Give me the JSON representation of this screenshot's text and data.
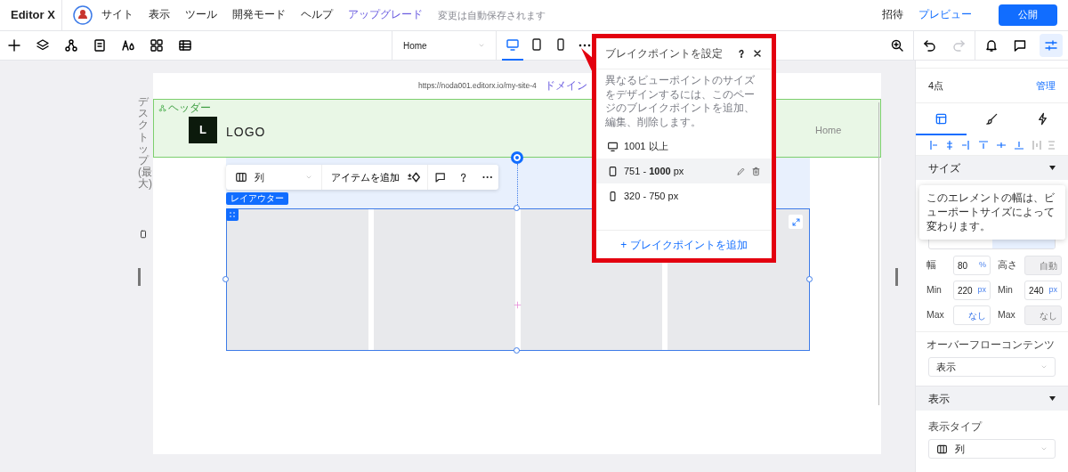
{
  "app": {
    "logo": "Editor X"
  },
  "menu": [
    {
      "label": "サイト",
      "kind": "item"
    },
    {
      "label": "表示",
      "kind": "item"
    },
    {
      "label": "ツール",
      "kind": "item"
    },
    {
      "label": "開発モード",
      "kind": "item"
    },
    {
      "label": "ヘルプ",
      "kind": "item"
    },
    {
      "label": "アップグレード",
      "kind": "upgrade"
    }
  ],
  "autosave_note": "変更は自動保存されます",
  "top_actions": {
    "invite": "招待",
    "preview": "プレビュー",
    "publish": "公開"
  },
  "toolbar": {
    "page_select": "Home",
    "devices": [
      {
        "kind": "desktop",
        "selected": true
      },
      {
        "kind": "tablet",
        "selected": false
      },
      {
        "kind": "mobile",
        "selected": false
      }
    ],
    "redo_disabled": true,
    "inspector_toggle_selected": true
  },
  "canvas": {
    "side_label": "デスクトップ (最大)",
    "url": "https://noda001.editorx.io/my-site-4",
    "domain_link": "ドメイン",
    "header": {
      "tag": "ヘッダー",
      "logo_letter": "L",
      "logo_text": "LOGO",
      "nav_item": "Home"
    },
    "section_toolbar": {
      "layout_select": "列",
      "add_item": "アイテムを追加"
    },
    "layouter_tag": "レイアウター",
    "columns": [
      {
        "kind": "cell"
      },
      {
        "kind": "cell"
      },
      {
        "kind": "cell"
      },
      {
        "kind": "cell"
      }
    ]
  },
  "breakpoints_popover": {
    "title": "ブレイクポイントを設定",
    "description": "異なるビューポイントのサイズをデザインするには、このページのブレイクポイントを追加、編集、削除します。",
    "items": [
      {
        "kind": "desktop",
        "label": "1001 以上",
        "selected": false
      },
      {
        "kind": "tablet",
        "label": "751 - **1000** px",
        "selected": true
      },
      {
        "kind": "mobile",
        "label": "320 - 750 px",
        "selected": false
      }
    ],
    "add_button": "+ ブレイクポイントを追加"
  },
  "inspector": {
    "count": "4点",
    "manage": "管理",
    "tabs": [
      {
        "kind": "layout",
        "selected": true
      },
      {
        "kind": "design",
        "selected": false
      },
      {
        "kind": "interactions",
        "selected": false
      }
    ],
    "size_section": {
      "title": "サイズ",
      "tooltip": "このエレメントの幅は、ビューポートサイズによって変わります。"
    },
    "fields": [
      {
        "label": "幅",
        "value": "80",
        "unit": "%",
        "disabled": false
      },
      {
        "label": "高さ",
        "value": "自動",
        "disabled": true
      },
      {
        "label": "Min",
        "value": "220",
        "unit": "px",
        "disabled": false
      },
      {
        "label": "Min",
        "value": "240",
        "unit": "px",
        "disabled": false
      },
      {
        "label": "Max",
        "value": "なし",
        "disabled": false
      },
      {
        "label": "Max",
        "value": "なし",
        "disabled": true
      }
    ],
    "overflow_label": "オーバーフローコンテンツ",
    "overflow_select": "表示",
    "display_section": {
      "title": "表示"
    },
    "display_type_label": "表示タイプ",
    "display_type_select": "列"
  }
}
